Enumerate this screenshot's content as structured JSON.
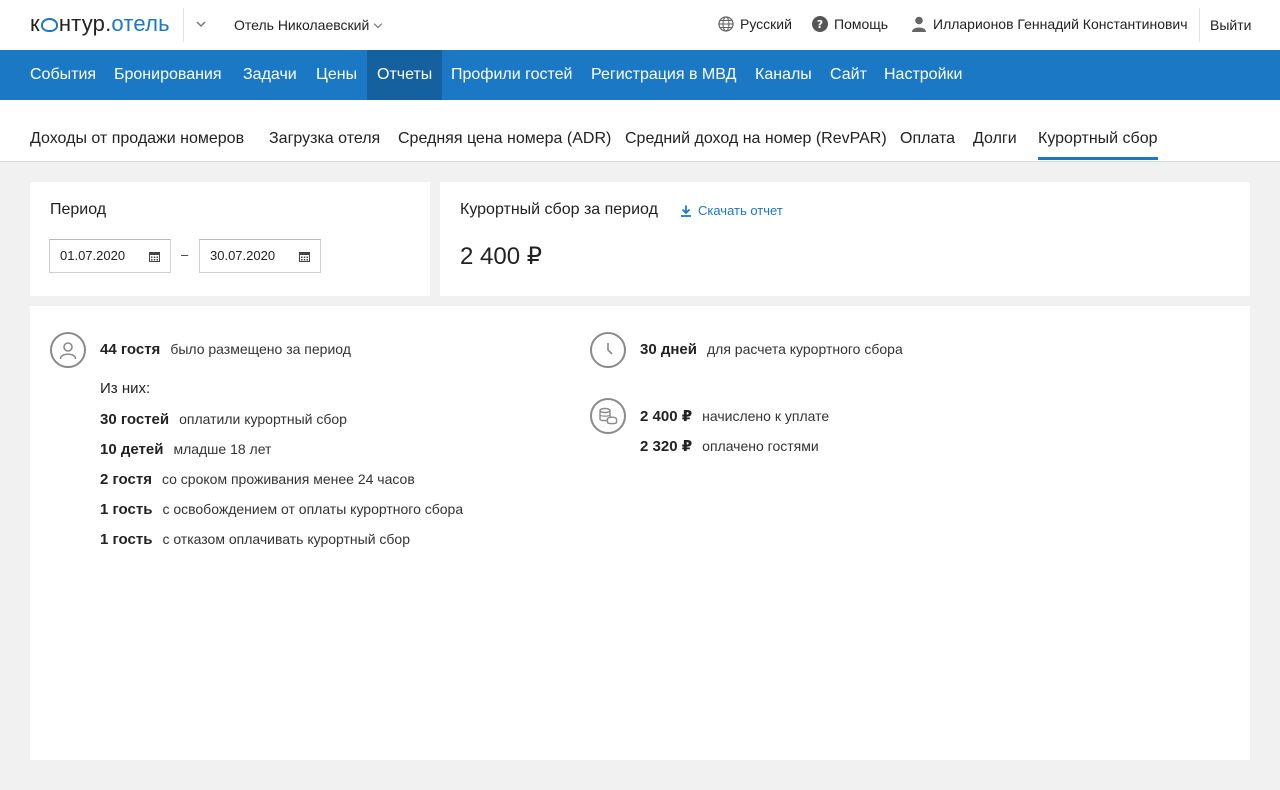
{
  "header": {
    "logo": {
      "part1": "к",
      "part2": "нтур.",
      "part3": "отель"
    },
    "hotel_name": "Отель Николаевский",
    "language": "Русский",
    "help": "Помощь",
    "user_name": "Илларионов Геннадий Константинович",
    "logout": "Выйти"
  },
  "nav": {
    "items": [
      "События",
      "Бронирования",
      "Задачи",
      "Цены",
      "Отчеты",
      "Профили гостей",
      "Регистрация в МВД",
      "Каналы",
      "Сайт",
      "Настройки"
    ],
    "active": "Отчеты"
  },
  "subtabs": {
    "items": [
      "Доходы от продажи номеров",
      "Загрузка отеля",
      "Средняя цена номера (ADR)",
      "Средний доход на номер (RevPAR)",
      "Оплата",
      "Долги",
      "Курортный сбор"
    ],
    "active": "Курортный сбор"
  },
  "period": {
    "title": "Период",
    "date_from": "01.07.2020",
    "separator": "–",
    "date_to": "30.07.2020"
  },
  "fee": {
    "title": "Курортный сбор за период",
    "download_label": "Скачать отчет",
    "amount": "2 400 ₽"
  },
  "stats": {
    "guests": {
      "num": "44 гостя",
      "desc": "было размещено за период"
    },
    "of_them_label": "Из них:",
    "breakdown": [
      {
        "num": "30 гостей",
        "desc": "оплатили курортный сбор"
      },
      {
        "num": "10 детей",
        "desc": "младше 18 лет"
      },
      {
        "num": "2 гостя",
        "desc": "со сроком проживания менее 24 часов"
      },
      {
        "num": "1 гость",
        "desc": "с освобождением от оплаты курортного сбора"
      },
      {
        "num": "1 гость",
        "desc": "с отказом оплачивать курортный сбор"
      }
    ],
    "days": {
      "num": "30 дней",
      "desc": "для расчета курортного сбора"
    },
    "charged": {
      "num": "2 400 ₽",
      "desc": "начислено к уплате"
    },
    "paid": {
      "num": "2 320 ₽",
      "desc": "оплачено гостями"
    }
  },
  "colors": {
    "brand": "#1b78c4",
    "nav_active": "#15609e",
    "background": "#f1f1f1"
  }
}
